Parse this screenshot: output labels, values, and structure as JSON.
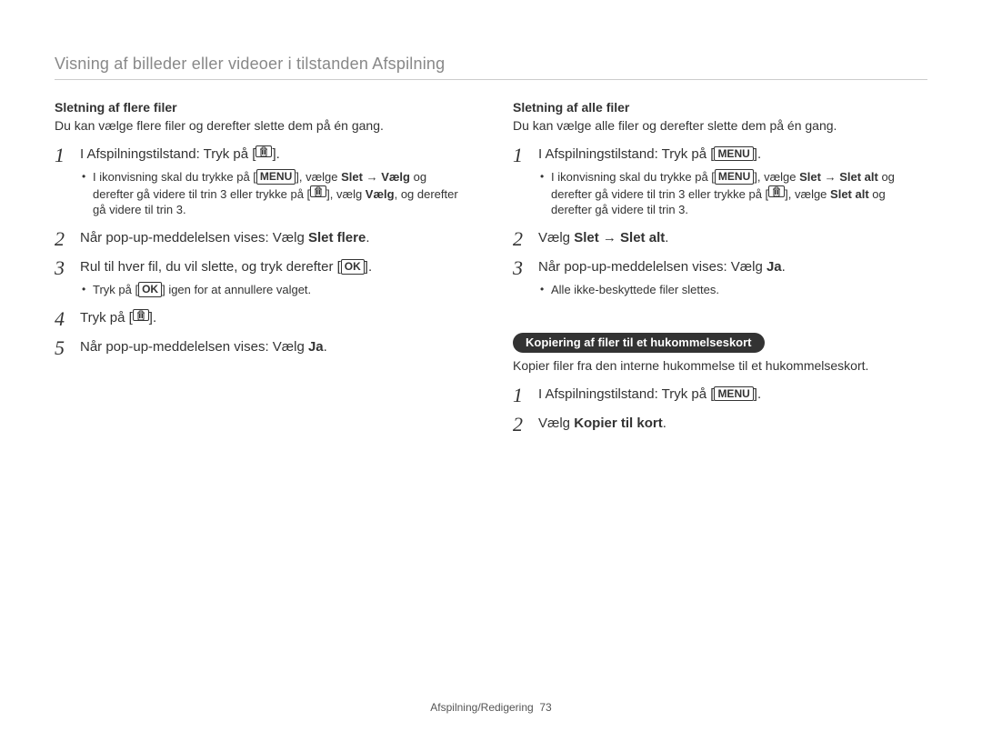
{
  "page": {
    "title": "Visning af billeder eller videoer i tilstanden Afspilning"
  },
  "labels": {
    "menu": "MENU",
    "ok": "OK"
  },
  "left": {
    "heading": "Sletning af flere filer",
    "intro": "Du kan vælge flere filer og derefter slette dem på én gang.",
    "step1_a": "I Afspilningstilstand: Tryk på [",
    "step1_b": "].",
    "step1_sub_a": "I ikonvisning skal du trykke på [",
    "step1_sub_b": "], vælge ",
    "step1_sub_bold1": "Slet",
    "step1_sub_arrow": " → ",
    "step1_sub_bold2": "Vælg",
    "step1_sub_c": " og derefter gå videre til trin 3 eller trykke på [",
    "step1_sub_d": "], vælg ",
    "step1_sub_bold3": "Vælg",
    "step1_sub_e": ", og derefter gå videre til trin 3.",
    "step2_a": "Når pop-up-meddelelsen vises: Vælg ",
    "step2_bold": "Slet flere",
    "step2_b": ".",
    "step3_a": "Rul til hver fil, du vil slette, og tryk derefter [",
    "step3_b": "].",
    "step3_sub_a": "Tryk på [",
    "step3_sub_b": "] igen for at annullere valget.",
    "step4_a": "Tryk på [",
    "step4_b": "].",
    "step5_a": "Når pop-up-meddelelsen vises: Vælg ",
    "step5_bold": "Ja",
    "step5_b": "."
  },
  "right": {
    "heading": "Sletning af alle filer",
    "intro": "Du kan vælge alle filer og derefter slette dem på én gang.",
    "step1_a": "I Afspilningstilstand: Tryk på [",
    "step1_b": "].",
    "step1_sub_a": "I ikonvisning skal du trykke på [",
    "step1_sub_b": "], vælge ",
    "step1_sub_bold1": "Slet",
    "step1_sub_arrow": " → ",
    "step1_sub_bold2": "Slet alt",
    "step1_sub_c": " og derefter gå videre til trin 3 eller trykke på [",
    "step1_sub_d": "], vælge ",
    "step1_sub_bold3": "Slet alt",
    "step1_sub_e": " og derefter gå videre til trin 3.",
    "step2_a": "Vælg ",
    "step2_bold1": "Slet",
    "step2_arrow": " → ",
    "step2_bold2": "Slet alt",
    "step2_b": ".",
    "step3_a": "Når pop-up-meddelelsen vises: Vælg ",
    "step3_bold": "Ja",
    "step3_b": ".",
    "step3_sub": "Alle ikke-beskyttede filer slettes.",
    "pill": "Kopiering af filer til et hukommelseskort",
    "pill_intro": "Kopier filer fra den interne hukommelse til et hukommelseskort.",
    "c_step1_a": "I Afspilningstilstand: Tryk på [",
    "c_step1_b": "].",
    "c_step2_a": "Vælg ",
    "c_step2_bold": "Kopier til kort",
    "c_step2_b": "."
  },
  "footer": {
    "section": "Afspilning/Redigering",
    "page_number": "73"
  }
}
